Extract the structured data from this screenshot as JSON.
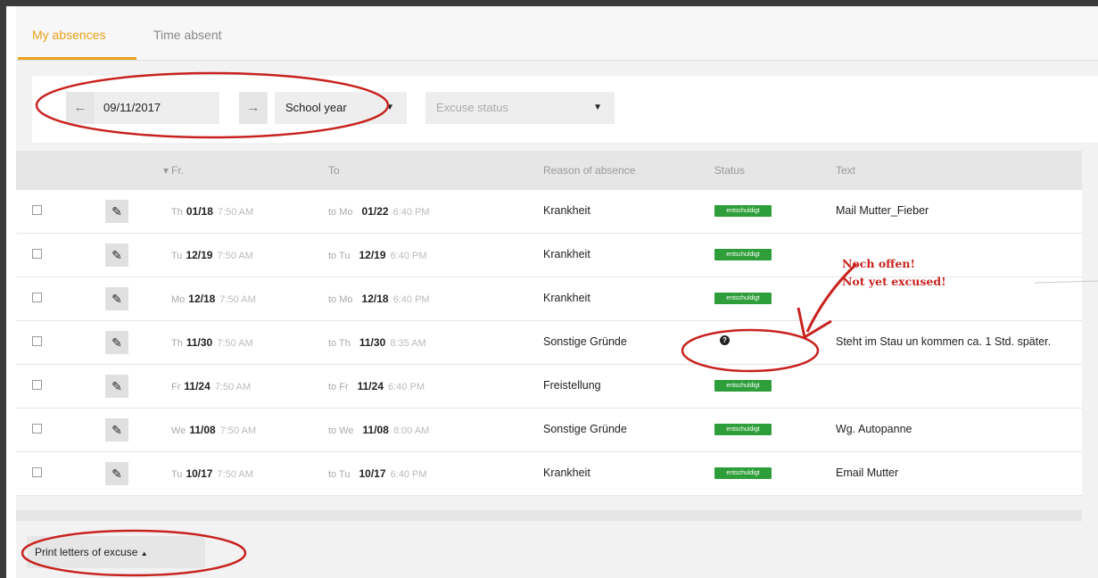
{
  "tabs": [
    {
      "label": "My absences",
      "active": true
    },
    {
      "label": "Time absent",
      "active": false
    }
  ],
  "filters": {
    "prev_icon": "arrow-left-icon",
    "next_icon": "arrow-right-icon",
    "date_value": "09/11/2017",
    "period_value": "School year",
    "excuse_placeholder": "Excuse status"
  },
  "table": {
    "headers": {
      "from": "Fr.",
      "to": "To",
      "reason": "Reason of absence",
      "status": "Status",
      "text": "Text"
    },
    "rows": [
      {
        "from_day": "Th",
        "from_date": "01/18",
        "from_time": "7:50 AM",
        "to_day": "to Mo",
        "to_date": "01/22",
        "to_time": "6:40 PM",
        "reason": "Krankheit",
        "status": "entschuldigt",
        "text": "Mail Mutter_Fieber"
      },
      {
        "from_day": "Tu",
        "from_date": "12/19",
        "from_time": "7:50 AM",
        "to_day": "to Tu",
        "to_date": "12/19",
        "to_time": "6:40 PM",
        "reason": "Krankheit",
        "status": "entschuldigt",
        "text": ""
      },
      {
        "from_day": "Mo",
        "from_date": "12/18",
        "from_time": "7:50 AM",
        "to_day": "to Mo",
        "to_date": "12/18",
        "to_time": "6:40 PM",
        "reason": "Krankheit",
        "status": "entschuldigt",
        "text": ""
      },
      {
        "from_day": "Th",
        "from_date": "11/30",
        "from_time": "7:50 AM",
        "to_day": "to Th",
        "to_date": "11/30",
        "to_time": "8:35 AM",
        "reason": "Sonstige Gründe",
        "status": "?",
        "text": "Steht im Stau un kommen ca. 1 Std. später."
      },
      {
        "from_day": "Fr",
        "from_date": "11/24",
        "from_time": "7:50 AM",
        "to_day": "to Fr",
        "to_date": "11/24",
        "to_time": "6:40 PM",
        "reason": "Freistellung",
        "status": "entschuldigt",
        "text": ""
      },
      {
        "from_day": "We",
        "from_date": "11/08",
        "from_time": "7:50 AM",
        "to_day": "to We",
        "to_date": "11/08",
        "to_time": "8:00 AM",
        "reason": "Sonstige Gründe",
        "status": "entschuldigt",
        "text": "Wg. Autopanne"
      },
      {
        "from_day": "Tu",
        "from_date": "10/17",
        "from_time": "7:50 AM",
        "to_day": "to Tu",
        "to_date": "10/17",
        "to_time": "6:40 PM",
        "reason": "Krankheit",
        "status": "entschuldigt",
        "text": "Email Mutter"
      }
    ]
  },
  "footer": {
    "print_label": "Print letters of excuse"
  },
  "annotation": {
    "line1": "Noch offen!",
    "line2": "Not yet excused!"
  },
  "colors": {
    "accent": "#e8a11a",
    "status_excused": "#2e9e3a",
    "annotation": "#c8221e"
  }
}
